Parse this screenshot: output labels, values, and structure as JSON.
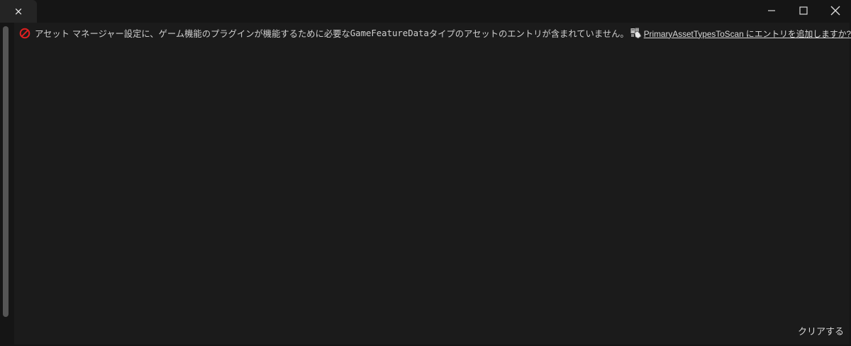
{
  "tab": {
    "close_label": "×"
  },
  "window_controls": {
    "minimize_icon": "minimize-icon",
    "maximize_icon": "maximize-icon",
    "close_icon": "close-icon"
  },
  "message": {
    "text_before": "アセット マネージャー設定に、ゲーム機能のプラグインが機能するために必要な",
    "code_text": "GameFeatureData",
    "text_after": "タイプのアセットのエントリが含まれていません。",
    "link_text": "PrimaryAssetTypesToScan にエントリを追加しますか?",
    "severity_icon": "error-no-entry-icon",
    "action_icon": "asset-fix-icon"
  },
  "footer": {
    "clear_label": "クリアする"
  },
  "colors": {
    "background": "#1b1b1b",
    "titlebar": "#151515",
    "error_red": "#e02020",
    "text": "#cfcfcf"
  }
}
